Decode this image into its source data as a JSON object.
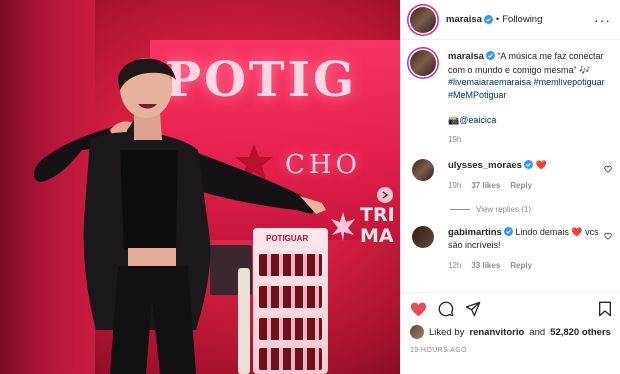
{
  "photo": {
    "sign_main": "POTIG",
    "sign_sub": "CHO",
    "sign_sub2_line1": "TRI",
    "sign_sub2_line2": "MA",
    "stand_label": "POTIGUAR",
    "box_label": "POTIGUAR"
  },
  "header": {
    "username": "maraisa",
    "separator": "•",
    "follow_label": "Following",
    "more_label": "···"
  },
  "caption": {
    "username": "maraisa",
    "text": "“A música me faz conectar com o mundo e comigo mesma” 🎶",
    "hashtags": [
      "#livemaiaraemaraisa",
      "#memlivepotiguar",
      "#MeMPotiguar"
    ],
    "credit_emoji": "📸",
    "mention": "@eaicica",
    "time": "19h"
  },
  "comments": [
    {
      "username": "ulysses_moraes",
      "text": "❤️",
      "time": "19h",
      "likes": "37 likes",
      "reply": "Reply",
      "view_replies": "View replies (1)"
    },
    {
      "username": "gabimartins",
      "text": "Lindo demais ❤️ vcs são incríveis!",
      "time": "12h",
      "likes": "33 likes",
      "reply": "Reply"
    }
  ],
  "footer": {
    "liked_by_prefix": "Liked by",
    "liked_by_user": "renanvitorio",
    "liked_by_and": "and",
    "liked_by_count": "52,820 others",
    "ago": "19 HOURS AGO"
  },
  "colors": {
    "heart": "#ed4956",
    "link": "#00376b",
    "verified": "#3897f0",
    "story_ring": "#d6249f"
  }
}
